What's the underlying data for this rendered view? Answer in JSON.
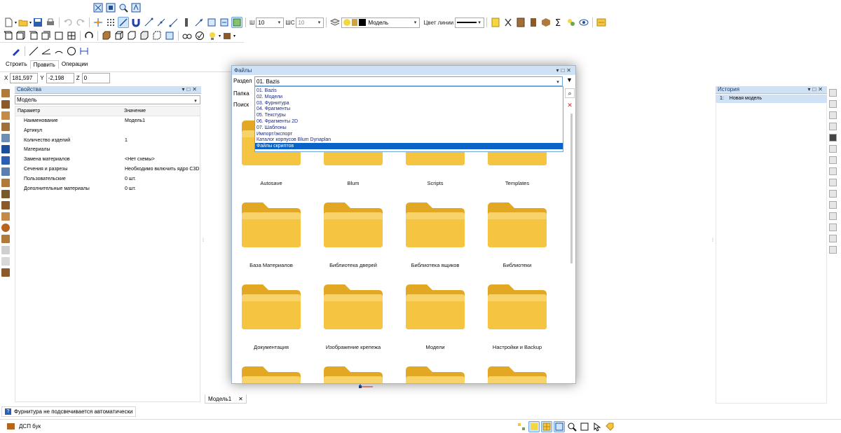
{
  "toolbar": {
    "line_width_label": "Ш",
    "line_width_value": "10",
    "line_width2_label": "ШС",
    "line_width2_value": "10",
    "layer_value": "Модель",
    "line_color_label": "Цвет линии"
  },
  "command_tabs": [
    "Строить",
    "Править",
    "Операции"
  ],
  "coords": {
    "x_label": "X",
    "x_value": "181,597",
    "y_label": "Y",
    "y_value": "-2,198",
    "z_label": "Z",
    "z_value": "0"
  },
  "properties": {
    "title": "Свойства",
    "selector_value": "Модель",
    "col_param": "Параметр",
    "col_value": "Значение",
    "rows": [
      {
        "name": "Наименование",
        "value": "Модель1"
      },
      {
        "name": "Артикул",
        "value": ""
      },
      {
        "name": "Количество изделий",
        "value": "1"
      },
      {
        "name": "Материалы",
        "value": ""
      },
      {
        "name": "Замена материалов",
        "value": "<Нет схемы>"
      },
      {
        "name": "Сечения и разрезы",
        "value": "Необходимо включить ядро C3D"
      },
      {
        "name": "Пользовательские",
        "value": "0 шт."
      },
      {
        "name": "Дополнительные материалы",
        "value": "0 шт."
      }
    ]
  },
  "history": {
    "title": "История",
    "item_index": "1:",
    "item_label": "Новая модель"
  },
  "files_dialog": {
    "title": "Файлы",
    "section_label": "Раздел",
    "section_value": "01. Bazis",
    "folder_label": "Папка",
    "search_label": "Поиск",
    "dropdown_options": [
      "01. Bazis",
      "02. Модели",
      "03. Фурнитура",
      "04. Фрагменты",
      "05. Текстуры",
      "06. Фрагменты 2D",
      "07. Шаблоны",
      "Импорт/экспорт",
      "Каталог корпусов Blum Dynaplan",
      "Файлы скриптов"
    ],
    "selected_option": "Файлы скриптов",
    "folders": [
      "Autosave",
      "Blum",
      "Scripts",
      "Templates",
      "База Материалов",
      "Библиотека дверей",
      "Библиотека ящиков",
      "Библиотеки",
      "Документация",
      "Изображение крепежа",
      "Модели",
      "Настройки и Backup"
    ]
  },
  "viewport_tab": "Модель1",
  "status": {
    "hint": "Фурнитура не подсвечивается автоматически",
    "material": "ДСП бук"
  },
  "colors": {
    "panel_header": "#cfe1f5",
    "folder_yellow": "#f5c542",
    "selection_blue": "#0a64c8"
  }
}
